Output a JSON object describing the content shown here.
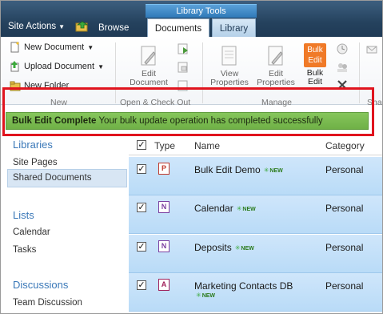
{
  "ribbon": {
    "site_actions": "Site Actions",
    "tab_browse": "Browse",
    "contextual_group": "Library Tools",
    "tab_documents": "Documents",
    "tab_library": "Library",
    "new_document": "New Document",
    "upload_document": "Upload Document",
    "new_folder": "New Folder",
    "group_new": "New",
    "edit_document_l1": "Edit",
    "edit_document_l2": "Document",
    "group_open_checkout": "Open & Check Out",
    "view_properties_l1": "View",
    "view_properties_l2": "Properties",
    "edit_properties_l1": "Edit",
    "edit_properties_l2": "Properties",
    "bulk_edit_icon_l1": "Bulk",
    "bulk_edit_icon_l2": "Edit",
    "bulk_edit_l1": "Bulk",
    "bulk_edit_l2": "Edit",
    "group_manage": "Manage",
    "group_share_partial": "Sha"
  },
  "status": {
    "title": "Bulk Edit Complete",
    "message": "Your bulk update operation has completed successfully"
  },
  "leftnav": {
    "libraries_heading": "Libraries",
    "libraries": [
      "Site Pages",
      "Shared Documents"
    ],
    "lists_heading": "Lists",
    "lists": [
      "Calendar",
      "Tasks"
    ],
    "discussions_heading": "Discussions",
    "discussions": [
      "Team Discussion"
    ]
  },
  "table": {
    "columns": [
      "Type",
      "Name",
      "Category"
    ],
    "new_label": "NEW",
    "rows": [
      {
        "type_letter": "P",
        "type_color": "#c0392b",
        "name": "Bulk Edit Demo",
        "category": "Personal"
      },
      {
        "type_letter": "N",
        "type_color": "#7b3fa0",
        "name": "Calendar",
        "category": "Personal"
      },
      {
        "type_letter": "N",
        "type_color": "#7b3fa0",
        "name": "Deposits",
        "category": "Personal"
      },
      {
        "type_letter": "A",
        "type_color": "#a0205a",
        "name": "Marketing Contacts DB",
        "category": "Personal"
      }
    ]
  },
  "colors": {
    "ribbon_dark": "#25425e",
    "library_tools": "#2f79b8",
    "status_green": "#6fb046",
    "highlight_red": "#e0141e",
    "row_selected": "#b9dbf7",
    "nav_link": "#3a78b8",
    "bulk_orange": "#f07a28"
  }
}
